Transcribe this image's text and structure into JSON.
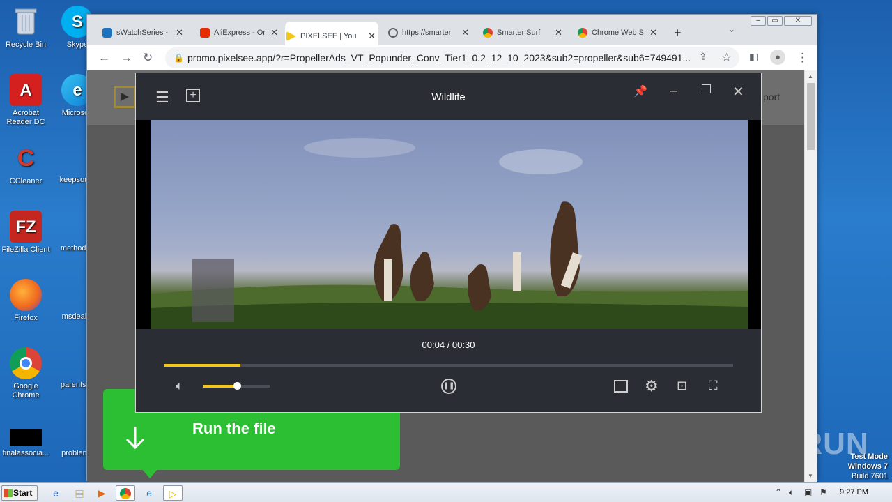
{
  "desktop": {
    "icons": [
      {
        "label": "Recycle Bin",
        "glyph": "trash-icon",
        "color": "#6c8fb8"
      },
      {
        "label": "Skype",
        "glyph": "skype-icon",
        "color": "#00aff0"
      },
      {
        "label": "Acrobat Reader DC",
        "glyph": "acrobat-icon",
        "color": "#d4201f"
      },
      {
        "label": "Microsoft",
        "glyph": "edge-icon",
        "color": "#0f7fd6"
      },
      {
        "label": "CCleaner",
        "glyph": "ccleaner-icon",
        "color": "#d33a2c"
      },
      {
        "label": "keepsome",
        "glyph": "blank",
        "color": ""
      },
      {
        "label": "FileZilla Client",
        "glyph": "filezilla-icon",
        "color": "#c4271f"
      },
      {
        "label": "methodsp",
        "glyph": "blank",
        "color": ""
      },
      {
        "label": "Firefox",
        "glyph": "firefox-icon",
        "color": "#f06b1e"
      },
      {
        "label": "msdeal.p",
        "glyph": "blank",
        "color": ""
      },
      {
        "label": "Google Chrome",
        "glyph": "chrome-icon",
        "color": "#2a8be0"
      },
      {
        "label": "parentsca",
        "glyph": "blank",
        "color": ""
      },
      {
        "label": "finalassocia...",
        "glyph": "black-file-icon",
        "color": "#000000"
      },
      {
        "label": "problemd",
        "glyph": "blank",
        "color": ""
      }
    ],
    "watermark": "ANY RUN",
    "test_mode": [
      "Test Mode",
      "Windows 7",
      "Build 7601"
    ]
  },
  "browser": {
    "tabs": [
      {
        "label": "sWatchSeries -",
        "icon_color": "#1e73be"
      },
      {
        "label": "AliExpress - Or",
        "icon_color": "#e62e04"
      },
      {
        "label": "PIXELSEE | You",
        "icon_color": "#f5c518"
      },
      {
        "label": "https://smarter",
        "icon_color": "#5f6368"
      },
      {
        "label": "Smarter Surf",
        "icon_color": "#e8453c"
      },
      {
        "label": "Chrome Web S",
        "icon_color": "#e8453c"
      }
    ],
    "new_tab": "+",
    "url": "promo.pixelsee.app/?r=PropellerAds_VT_Popunder_Conv_Tier1_0.2_12_10_2023&sub2=propeller&sub6=749491...",
    "page_support_text": "port",
    "page_logo": "▶"
  },
  "player": {
    "title": "Wildlife",
    "time": "00:04 / 00:30",
    "progress_fraction": 0.133,
    "volume_fraction": 0.5
  },
  "banner": {
    "text": "Run the file",
    "color": "#2cbf33"
  },
  "taskbar": {
    "start": "Start",
    "clock": "9:27 PM"
  }
}
